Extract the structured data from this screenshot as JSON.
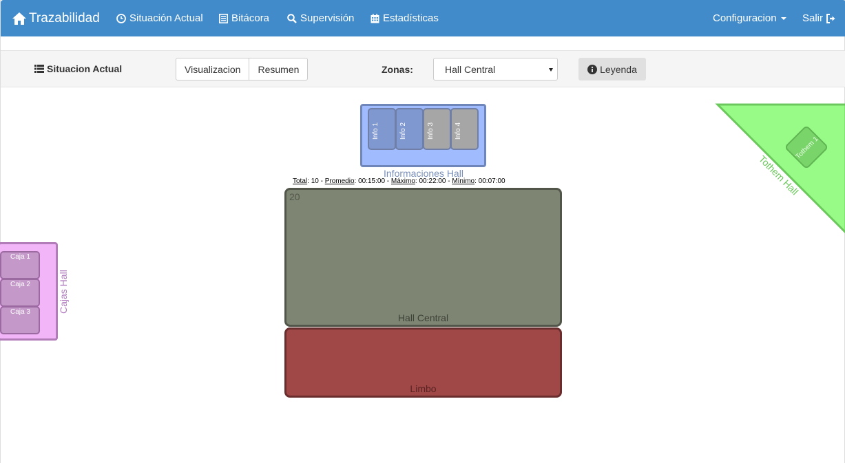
{
  "navbar": {
    "brand": "Trazabilidad",
    "links": [
      "Situación Actual",
      "Bitácora",
      "Supervisión",
      "Estadísticas"
    ],
    "config": "Configuracion",
    "logout": "Salir"
  },
  "toolbar": {
    "title": "Situacion Actual",
    "view_buttons": [
      "Visualizacion",
      "Resumen"
    ],
    "zones_label": "Zonas:",
    "selected_zone": "Hall Central",
    "legend_button": "Leyenda"
  },
  "map": {
    "info_hall": {
      "label": "Informaciones Hall",
      "boxes": [
        {
          "label": "Info 1",
          "color": "#8098d0"
        },
        {
          "label": "Info 2",
          "color": "#8098d0"
        },
        {
          "label": "Info 3",
          "color": "#a6a6a6"
        },
        {
          "label": "Info 4",
          "color": "#a6a6a6"
        }
      ]
    },
    "stats": {
      "total_label": "Total",
      "total": "10",
      "promedio_label": "Promedio",
      "promedio": "00:15:00",
      "maximo_label": "Máximo",
      "maximo": "00:22:00",
      "minimo_label": "Mínimo",
      "minimo": "00:07:00"
    },
    "hall_central": {
      "label": "Hall Central",
      "count": "20"
    },
    "limbo": {
      "label": "Limbo"
    },
    "cajas": {
      "label": "Cajas Hall",
      "items": [
        "Caja 1",
        "Caja 2",
        "Caja 3"
      ]
    },
    "tothem": {
      "label": "Tothem Hall",
      "item": "Tothem 1"
    }
  },
  "colors": {
    "navbar": "#428bca",
    "info_hall": "#a0bcff",
    "hall_central": "#7f8573",
    "limbo": "#a04848",
    "cajas": "#f2b6f8",
    "tothem": "#98fb88"
  }
}
